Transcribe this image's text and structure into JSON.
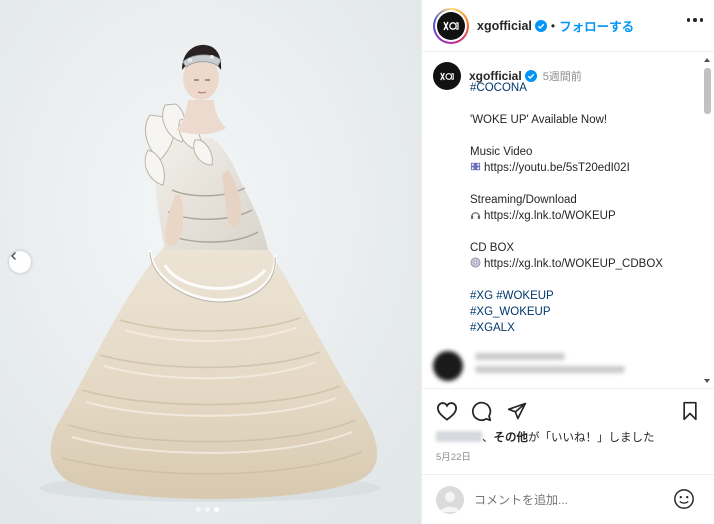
{
  "post": {
    "username": "xgofficial",
    "follow_label": "フォローする",
    "separator": "•",
    "time_ago": "5週間前",
    "caption_lines": [
      {
        "text": "#COCONA",
        "kind": "hashtag"
      },
      {
        "text": "",
        "kind": "gap"
      },
      {
        "text": "'WOKE UP' Available Now!",
        "kind": "text"
      },
      {
        "text": "",
        "kind": "gap"
      },
      {
        "text": "Music Video",
        "kind": "text"
      },
      {
        "text": "https://youtu.be/5sT20edI02I",
        "kind": "link",
        "icon": "film-frames-icon"
      },
      {
        "text": "",
        "kind": "gap"
      },
      {
        "text": "Streaming/Download",
        "kind": "text"
      },
      {
        "text": "https://xg.lnk.to/WOKEUP",
        "kind": "link",
        "icon": "headphones-icon"
      },
      {
        "text": "",
        "kind": "gap"
      },
      {
        "text": "CD BOX",
        "kind": "text"
      },
      {
        "text": "https://xg.lnk.to/WOKEUP_CDBOX",
        "kind": "link",
        "icon": "disc-icon"
      },
      {
        "text": "",
        "kind": "gap"
      },
      {
        "text": "#XG #WOKEUP",
        "kind": "hashtag"
      },
      {
        "text": "#XG_WOKEUP",
        "kind": "hashtag"
      },
      {
        "text": "#XGALX",
        "kind": "hashtag"
      }
    ],
    "likes_suffix": "、",
    "likes_bold": "その他",
    "likes_text": "が「いいね！」しました",
    "date": "5月22日",
    "comment_placeholder": "コメントを追加...",
    "carousel": {
      "count": 3,
      "active": 2
    }
  },
  "colors": {
    "accent": "#0095f6",
    "hashtag": "#00376b",
    "muted": "#8e8e8e",
    "verified": "#0095f6"
  },
  "icons": [
    "chevron-left-icon",
    "verified-badge-icon",
    "more-icon",
    "heart-icon",
    "comment-icon",
    "share-icon",
    "bookmark-icon",
    "smile-icon"
  ]
}
